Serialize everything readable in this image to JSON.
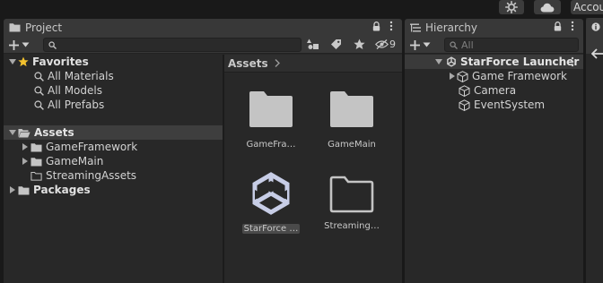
{
  "topbar": {
    "account_label": "Account",
    "icons": [
      "settings-gear-icon",
      "cloud-icon"
    ]
  },
  "project": {
    "tab_title": "Project",
    "tab_icon": "folder-icon",
    "search": {
      "value": "",
      "placeholder": ""
    },
    "hidden_count": "9",
    "tree": {
      "favorites": {
        "label": "Favorites",
        "items": [
          "All Materials",
          "All Models",
          "All Prefabs"
        ]
      },
      "assets": {
        "label": "Assets",
        "children": [
          "GameFramework",
          "GameMain",
          "StreamingAssets"
        ]
      },
      "packages": {
        "label": "Packages"
      }
    },
    "breadcrumb": {
      "root": "Assets"
    },
    "grid": [
      {
        "label": "GameFra…",
        "icon": "folder-icon"
      },
      {
        "label": "GameMain",
        "icon": "folder-icon"
      },
      {
        "label": "StarForce …",
        "icon": "unity-logo-icon"
      },
      {
        "label": "Streaming…",
        "icon": "empty-folder-icon"
      }
    ]
  },
  "hierarchy": {
    "tab_title": "Hierarchy",
    "tab_icon": "list-icon",
    "search": {
      "value": "",
      "placeholder": "All"
    },
    "scene": {
      "label": "StarForce Launcher",
      "children": [
        "Game Framework",
        "Camera",
        "EventSystem"
      ]
    }
  },
  "colors": {
    "accent_star": "#f2c12e",
    "unity_logo": "#c7cde6",
    "folder": "#c4c4c4",
    "selected_row": "#3e3e3e"
  }
}
